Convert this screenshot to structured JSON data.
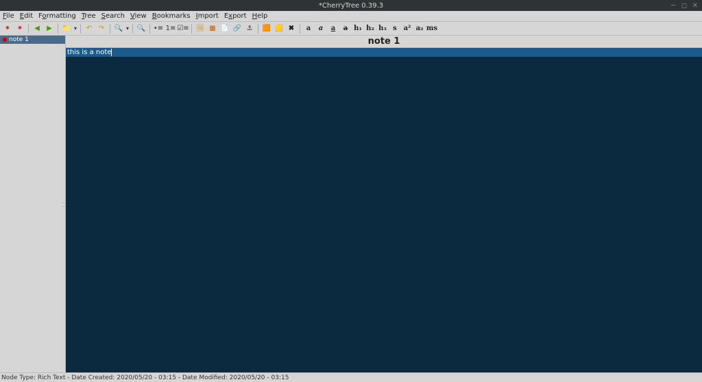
{
  "titlebar": {
    "title": "*CherryTree 0.39.3"
  },
  "menu": {
    "file": "File",
    "edit": "Edit",
    "formatting": "Formatting",
    "tree": "Tree",
    "search": "Search",
    "view": "View",
    "bookmarks": "Bookmarks",
    "import": "Import",
    "export": "Export",
    "help": "Help"
  },
  "toolbar_icons": {
    "new_node": "✶",
    "new_sub": "✶",
    "back": "◀",
    "forward": "▶",
    "save": "💾",
    "save_dd": "▾",
    "undo": "↶",
    "redo": "↷",
    "find": "🔍",
    "find_dd": "▾",
    "zoom_in": "🔍+",
    "list_bullet": "≣",
    "list_number": "≣",
    "list_todo": "≣",
    "copy": "📄",
    "paste": "📋",
    "image": "🖼",
    "link": "🔗",
    "code": "📄",
    "anchor": "⚓",
    "color_fg": "🎨",
    "color_bg": "🖍",
    "clear_fmt": "✖a",
    "bold": "a",
    "italic": "a",
    "underline": "a",
    "strike": "a",
    "h1": "h₁",
    "h2": "h₂",
    "h3": "h₃",
    "small": "s",
    "sup": "a²",
    "sub": "a₂",
    "mono": "ms"
  },
  "sidebar": {
    "item1": "note 1"
  },
  "note": {
    "title": "note 1",
    "content": "this is a note"
  },
  "statusbar": {
    "text": "Node Type: Rich Text  -   Date Created: 2020/05/20 - 03:15  -   Date Modified: 2020/05/20 - 03:15"
  }
}
